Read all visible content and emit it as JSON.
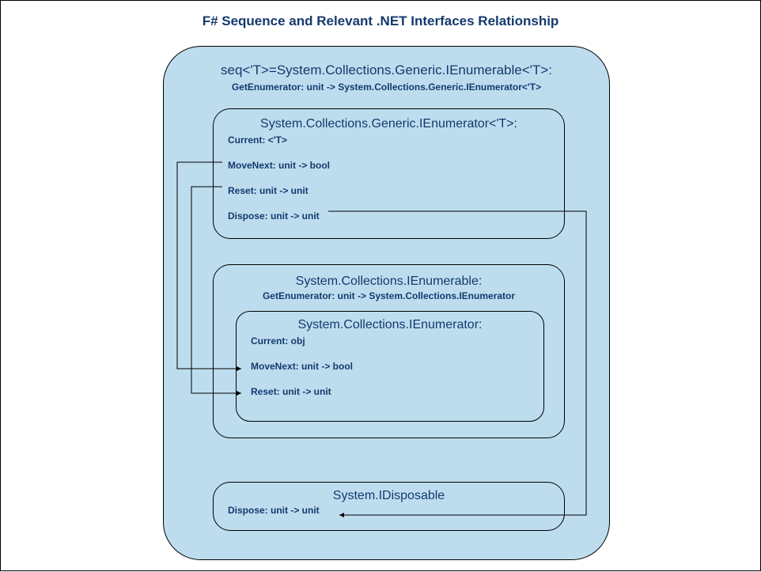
{
  "title": "F# Sequence and Relevant .NET Interfaces Relationship",
  "outer": {
    "heading": "seq<'T>=System.Collections.Generic.IEnumerable<'T>:",
    "sub": "GetEnumerator: unit -> System.Collections.Generic.IEnumerator<'T>"
  },
  "genericEnumerator": {
    "heading": "System.Collections.Generic.IEnumerator<'T>:",
    "current": "Current: <'T>",
    "moveNext": "MoveNext: unit -> bool",
    "reset": "Reset: unit -> unit",
    "dispose": "Dispose: unit -> unit"
  },
  "ienumerable": {
    "heading": "System.Collections.IEnumerable:",
    "sub": "GetEnumerator: unit -> System.Collections.IEnumerator"
  },
  "ienumerator": {
    "heading": "System.Collections.IEnumerator:",
    "current": "Current: obj",
    "moveNext": "MoveNext: unit -> bool",
    "reset": "Reset: unit -> unit"
  },
  "idisposable": {
    "heading": "System.IDisposable",
    "dispose": "Dispose: unit -> unit"
  }
}
